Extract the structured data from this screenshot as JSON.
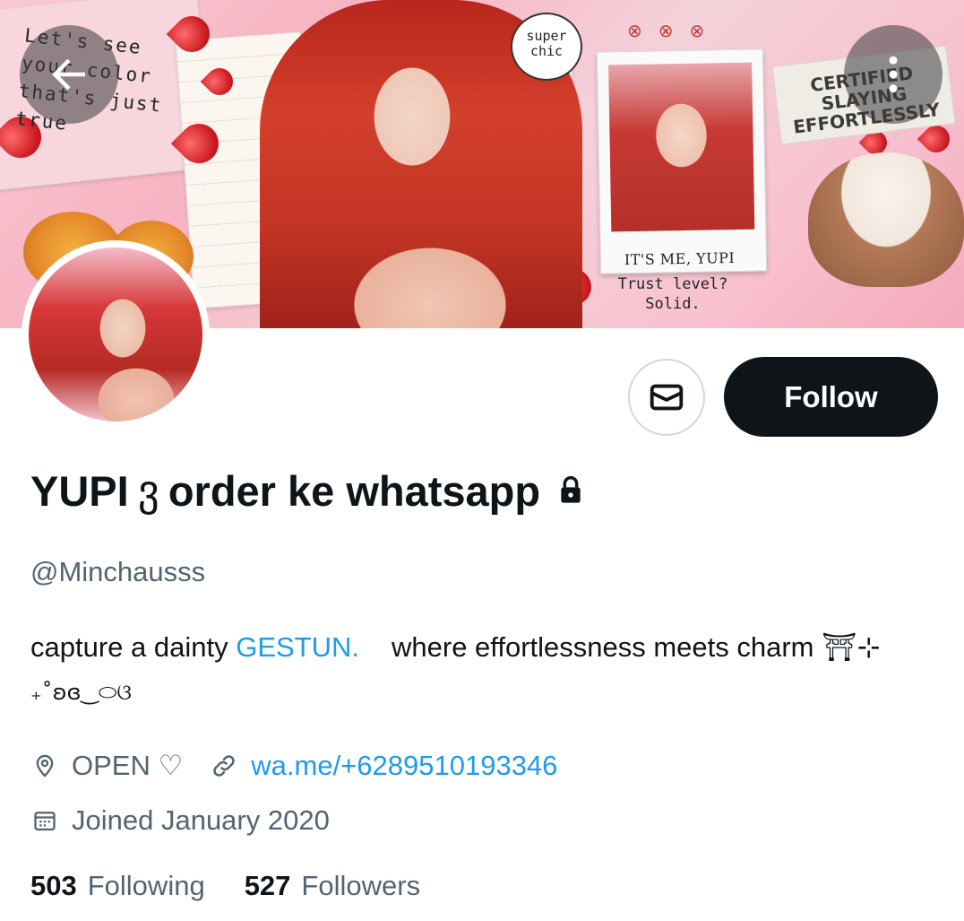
{
  "header": {
    "back_icon": "arrow-left-icon",
    "more_icon": "more-vertical-icon"
  },
  "banner": {
    "scribble_text": "Let's see your color that's just true",
    "bubble_text": "super chic",
    "stamp_text": "CERTIFIED SLAYING EFFORTLESSLY",
    "polaroid_caption": "IT'S ME, YUPI",
    "note_text": "Trust level? Solid."
  },
  "actions": {
    "message_icon": "mail-icon",
    "follow_label": "Follow"
  },
  "profile": {
    "display_name_part1": "YUPI",
    "display_name_symbol": "ვ",
    "display_name_part2": "order ke whatsapp",
    "lock_icon": "lock-icon",
    "handle": "@Minchausss",
    "bio_line1_start": "capture a dainty ",
    "bio_link": "GESTUN.",
    "bio_line1_end": "where effortlessness meets charm ⛩⊹",
    "bio_line2": "₊˚ʚɞ‿⬭ଓ",
    "location": "OPEN ♡",
    "location_icon": "location-pin-icon",
    "website": "wa.me/+6289510193346",
    "website_icon": "link-icon",
    "joined": "Joined January 2020",
    "calendar_icon": "calendar-icon"
  },
  "stats": {
    "following_count": "503",
    "following_label": "Following",
    "followers_count": "527",
    "followers_label": "Followers"
  },
  "colors": {
    "link": "#1d9bf0",
    "text_primary": "#0f1419",
    "text_secondary": "#536471",
    "follow_bg": "#0f1419"
  }
}
